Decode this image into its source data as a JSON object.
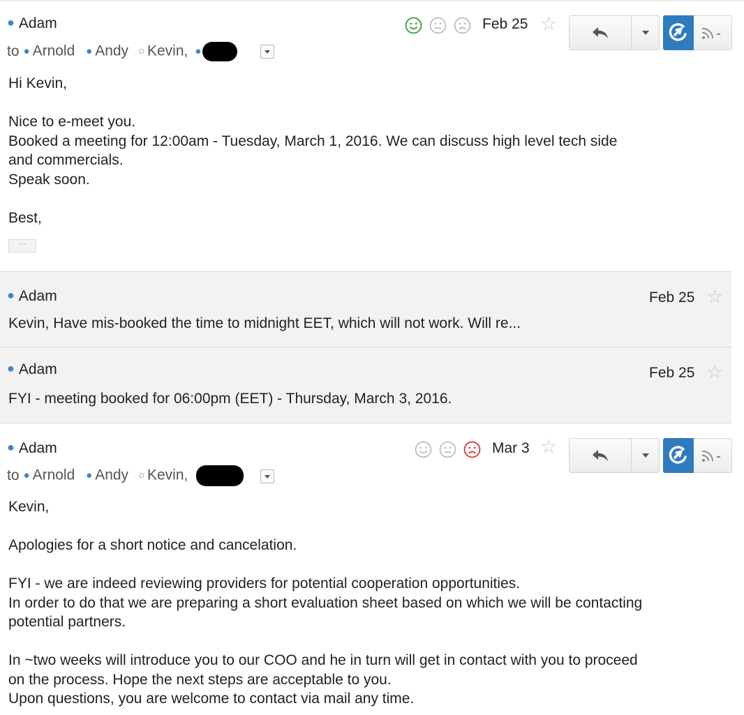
{
  "messages": [
    {
      "sender": "Adam",
      "date": "Feb 25",
      "to_label": "to",
      "recipients": [
        "Arnold",
        "Andy",
        "Kevin,"
      ],
      "body": [
        "Hi Kevin,",
        "",
        "Nice to e-meet you.",
        "Booked a meeting for 12:00am - Tuesday, March 1, 2016. We can discuss high level tech side",
        "and commercials.",
        "Speak soon.",
        "",
        "Best,"
      ],
      "trimmed_label": "···"
    },
    {
      "sender": "Adam",
      "date": "Feb 25",
      "snippet": "Kevin, Have mis-booked the time to midnight EET, which will not work. Will re..."
    },
    {
      "sender": "Adam",
      "date": "Feb 25",
      "snippet": "FYI - meeting booked for 06:00pm (EET) - Thursday, March 3, 2016."
    },
    {
      "sender": "Adam",
      "date": "Mar 3",
      "to_label": "to",
      "recipients": [
        "Arnold",
        "Andy",
        "Kevin,"
      ],
      "body": [
        "Kevin,",
        "",
        "Apologies for a short notice and cancelation.",
        "",
        "FYI - we are indeed reviewing providers for potential cooperation opportunities.",
        "In order to do that we are preparing a short evaluation sheet based on which we will be contacting",
        "potential partners.",
        "",
        "In ~two weeks will introduce you to our COO and he in turn will get in contact with you to proceed",
        "on the process. Hope the next steps are acceptable to you.",
        "Upon questions, you are welcome to contact via mail any time."
      ]
    }
  ],
  "icons": {
    "sender_dot": "blue-bullet-icon",
    "star": "star-outline-icon",
    "reply": "reply-arrow-icon",
    "extension": "extension-logo-icon",
    "rss": "rss-icon",
    "smiley_happy": "smiley-happy-icon",
    "smiley_neutral": "smiley-neutral-icon",
    "smiley_sad": "smiley-sad-icon"
  },
  "colors": {
    "accent_blue": "#2f7bc0",
    "happy_active": "#3aa33a",
    "sad_active": "#d93a3a",
    "inactive_icon": "#b5b5b5"
  },
  "message_1_reaction": "happy",
  "message_4_reaction": "sad"
}
